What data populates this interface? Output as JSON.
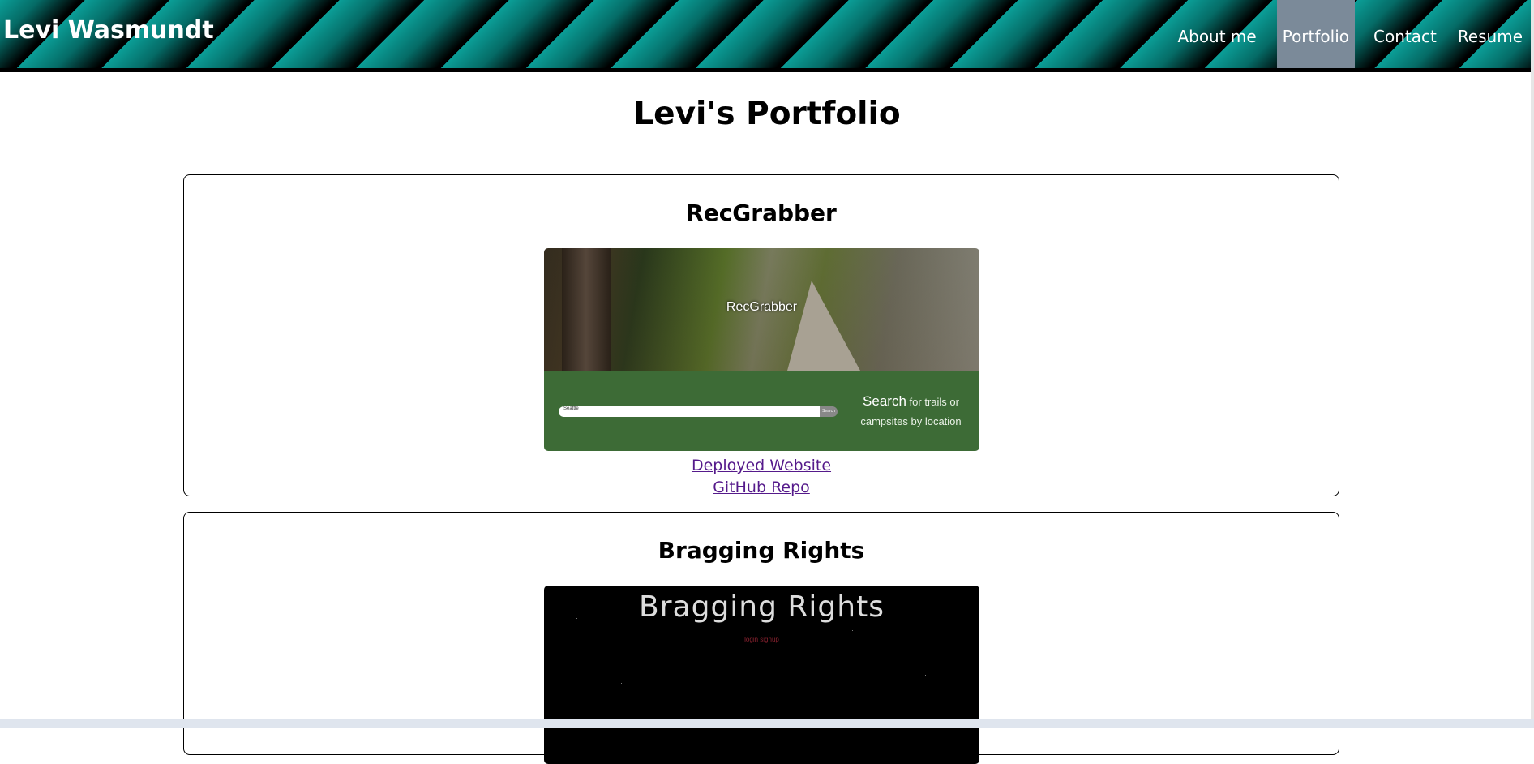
{
  "header": {
    "site_title": "Levi Wasmundt",
    "nav": [
      {
        "label": "About me",
        "active": false
      },
      {
        "label": "Portfolio",
        "active": true
      },
      {
        "label": "Contact",
        "active": false
      },
      {
        "label": "Resume",
        "active": false
      }
    ]
  },
  "page": {
    "title": "Levi's Portfolio"
  },
  "projects": [
    {
      "title": "RecGrabber",
      "screenshot": {
        "hero_label": "RecGrabber",
        "search_placeholder": "Seattle",
        "search_button": "Search",
        "search_heading": "Search",
        "search_subtext": "for trails or campsites by location"
      },
      "links": {
        "deployed": "Deployed Website",
        "repo": "GitHub Repo"
      }
    },
    {
      "title": "Bragging Rights",
      "screenshot": {
        "heading": "Bragging Rights",
        "auth_links": "login signup"
      }
    }
  ],
  "colors": {
    "header_teal": "#0b9e97",
    "nav_active_bg": "#7b8a99",
    "search_band_green": "#3d6b36",
    "link_visited": "#551a8b"
  }
}
